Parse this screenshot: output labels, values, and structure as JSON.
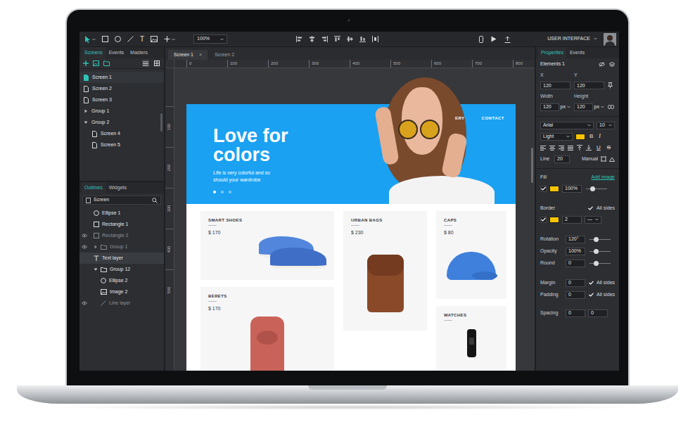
{
  "toolbar": {
    "text_tool": "T",
    "zoom": "100%",
    "mode": "USER INTERFACE"
  },
  "screen_tabs": [
    {
      "label": "Screen 1",
      "close": "×",
      "selected": true
    },
    {
      "label": "Screen 2",
      "selected": false
    }
  ],
  "left_tabs": [
    {
      "label": "Screens",
      "selected": true
    },
    {
      "label": "Events",
      "selected": false
    },
    {
      "label": "Masters",
      "selected": false
    }
  ],
  "screens": [
    {
      "label": "Screen 1",
      "kind": "screen",
      "depth": 0,
      "selected": true
    },
    {
      "label": "Screen 2",
      "kind": "screen",
      "depth": 0,
      "selected": false
    },
    {
      "label": "Screen 3",
      "kind": "screen",
      "depth": 0,
      "selected": false
    },
    {
      "label": "Group 1",
      "kind": "group",
      "depth": 0,
      "expanded": false,
      "selected": false
    },
    {
      "label": "Group 2",
      "kind": "group",
      "depth": 0,
      "expanded": true,
      "selected": false
    },
    {
      "label": "Screen 4",
      "kind": "screen",
      "depth": 1,
      "selected": false
    },
    {
      "label": "Screen 5",
      "kind": "screen",
      "depth": 1,
      "selected": false
    }
  ],
  "outline_tabs": [
    {
      "label": "Outlines",
      "selected": true
    },
    {
      "label": "Widgets",
      "selected": false
    }
  ],
  "outline_search": {
    "value": "Screen"
  },
  "outlines": [
    {
      "label": "Ellipse 1",
      "kind": "ellipse",
      "depth": 0,
      "hidden": false,
      "selected": false
    },
    {
      "label": "Rectangle 1",
      "kind": "rectangle",
      "depth": 0,
      "hidden": false,
      "selected": false
    },
    {
      "label": "Rectangle 2",
      "kind": "rectangle",
      "depth": 0,
      "hidden": true,
      "selected": false
    },
    {
      "label": "Group 1",
      "kind": "group",
      "depth": 0,
      "hidden": true,
      "expanded": false,
      "selected": false
    },
    {
      "label": "Text layer",
      "kind": "text",
      "depth": 0,
      "hidden": false,
      "selected": true
    },
    {
      "label": "Group 12",
      "kind": "group",
      "depth": 0,
      "hidden": false,
      "expanded": true,
      "selected": false
    },
    {
      "label": "Ellipse 2",
      "kind": "ellipse",
      "depth": 1,
      "hidden": false,
      "selected": false
    },
    {
      "label": "Image 2",
      "kind": "image",
      "depth": 1,
      "hidden": false,
      "selected": false
    },
    {
      "label": "Line layer",
      "kind": "line",
      "depth": 1,
      "hidden": true,
      "selected": false
    }
  ],
  "rulers": {
    "top": [
      "0",
      "100",
      "200",
      "300",
      "400",
      "500",
      "600",
      "700",
      "800"
    ],
    "left": [
      "100",
      "200",
      "300",
      "400",
      "500"
    ]
  },
  "artboard": {
    "hero": {
      "title": "Love for colors",
      "subtitle": "Life is very colorful and so should your wardrobe",
      "nav": [
        "ERY",
        "CONTACT"
      ],
      "slides": [
        {
          "selected": true
        },
        {
          "selected": false
        },
        {
          "selected": false
        }
      ]
    },
    "products": [
      [
        {
          "name": "SMART SHOES",
          "price": "$ 170",
          "kind": "shoes"
        },
        {
          "name": "BERETS",
          "price": "$ 170",
          "kind": "scarf"
        }
      ],
      [
        {
          "name": "URBAN BAGS",
          "price": "$ 230",
          "kind": "bag"
        }
      ],
      [
        {
          "name": "CAPS",
          "price": "$ 80",
          "kind": "cap"
        },
        {
          "name": "WATCHES",
          "kind": "watch"
        }
      ]
    ]
  },
  "properties": {
    "tabs": [
      {
        "label": "Properties",
        "selected": true
      },
      {
        "label": "Events",
        "selected": false
      }
    ],
    "element": "Elements 1",
    "position": [
      {
        "label": "X",
        "value": "120"
      },
      {
        "label": "Y",
        "value": "120"
      }
    ],
    "size": [
      {
        "label": "Width",
        "value": "120",
        "unit": "px"
      },
      {
        "label": "Height",
        "value": "120",
        "unit": "px"
      }
    ],
    "font": {
      "family": "Arial",
      "size": "10",
      "weight": "Light",
      "color": "#f5c400"
    },
    "style_buttons": [
      "B",
      "I"
    ],
    "decor_buttons": [
      "U",
      "S"
    ],
    "line": {
      "label": "Line",
      "value": "20",
      "mode": "Manual"
    },
    "fill": {
      "label": "Fill",
      "link": "Add image",
      "checked": true,
      "color": "#f5c400",
      "opacity": "100%",
      "level": 0.3
    },
    "border": {
      "label": "Border",
      "all_sides": {
        "label": "All sides",
        "checked": true
      },
      "checked": true,
      "color": "#f5c400",
      "width": "2",
      "style": "—"
    },
    "sliders": [
      {
        "label": "Rotation",
        "value": "120°",
        "level": 0.3
      },
      {
        "label": "Opacity",
        "value": "100%",
        "level": 0.3
      },
      {
        "label": "Round",
        "value": "0",
        "level": 0.3
      }
    ],
    "spacing_rows": [
      {
        "label": "Margin",
        "value": "0",
        "all_sides": "All sides",
        "checked": true
      },
      {
        "label": "Padding",
        "value": "0",
        "all_sides": "All sides",
        "checked": true
      }
    ],
    "spacing": {
      "label": "Spacing",
      "values": [
        "0",
        "0"
      ]
    }
  }
}
